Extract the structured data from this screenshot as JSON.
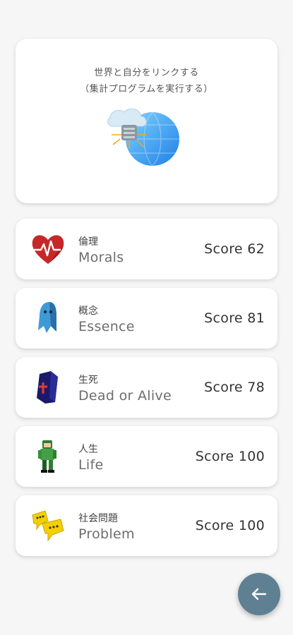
{
  "hero": {
    "line1": "世界と自分をリンクする",
    "line2": "（集計プログラムを実行する）",
    "illustration_icon": "globe-cloud-icon"
  },
  "cards": [
    {
      "jp": "倫理",
      "en": "Morals",
      "score": "Score 62",
      "icon": "heart-pulse-icon"
    },
    {
      "jp": "概念",
      "en": "Essence",
      "score": "Score 81",
      "icon": "ghost-figure-icon"
    },
    {
      "jp": "生死",
      "en": "Dead or Alive",
      "score": "Score 78",
      "icon": "coffin-icon"
    },
    {
      "jp": "人生",
      "en": "Life",
      "score": "Score 100",
      "icon": "person-figure-icon"
    },
    {
      "jp": "社会問題",
      "en": "Problem",
      "score": "Score 100",
      "icon": "chat-bubbles-icon"
    }
  ],
  "fab": {
    "icon": "arrow-left-icon",
    "color": "#5f8092"
  }
}
